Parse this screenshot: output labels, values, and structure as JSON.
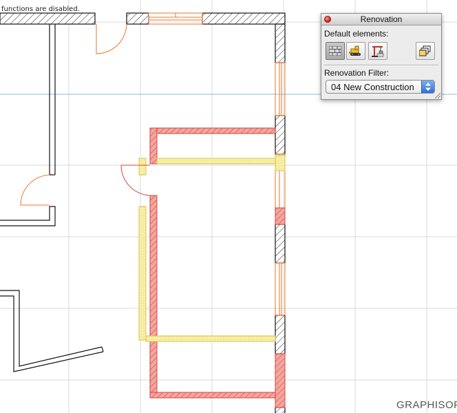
{
  "status_message": "functions are disabled.",
  "watermark": "GRAPHISOF",
  "palette": {
    "title": "Renovation",
    "default_elements_label": "Default elements:",
    "tools": [
      {
        "name": "existing-elements-icon",
        "selected": true
      },
      {
        "name": "to-be-demolished-icon",
        "selected": false
      },
      {
        "name": "new-construction-icon",
        "selected": false
      },
      {
        "name": "renovation-settings-icon",
        "selected": false
      }
    ],
    "filter_label": "Renovation Filter:",
    "filter_value": "04 New Construction"
  },
  "colors": {
    "grid": "#d9d9d9",
    "guide_line": "#8fb8d6",
    "existing_wall": "#111111",
    "demolished_fill": "#f7f0a8",
    "demolished_stroke": "#d8c24a",
    "new_fill": "#f4a6a0",
    "new_stroke": "#d9433c",
    "door_arc": "#e8762a",
    "selected_button": "#b5b5b5",
    "popup_arrow": "#2f6fd6"
  }
}
